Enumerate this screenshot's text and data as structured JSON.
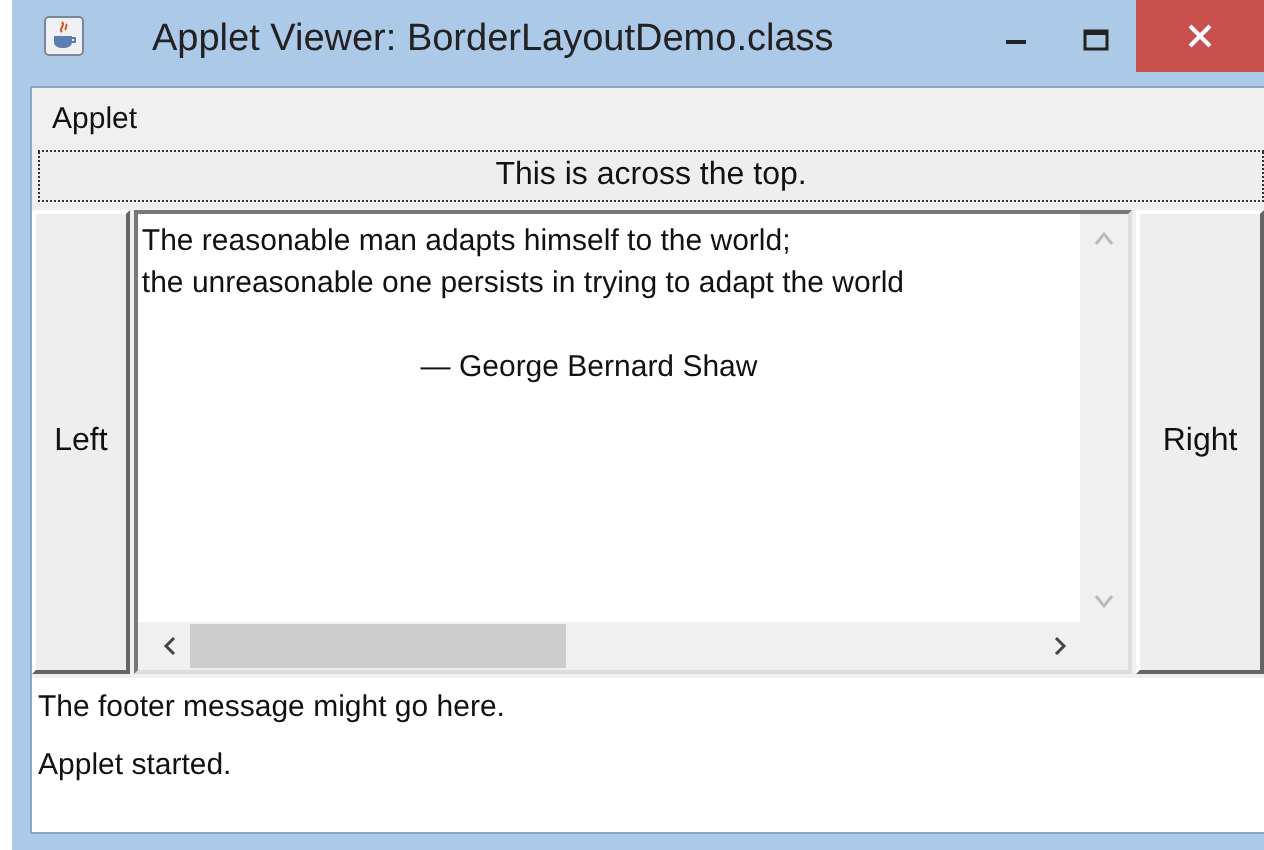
{
  "window": {
    "title": "Applet Viewer: BorderLayoutDemo.class"
  },
  "menu_bar": {
    "items": [
      "Applet"
    ]
  },
  "north_button": {
    "label": "This is across the top."
  },
  "west_button": {
    "label": "Left"
  },
  "east_button": {
    "label": "Right"
  },
  "text_area": {
    "lines": [
      "The reasonable man adapts himself to the world;",
      "the unreasonable one persists in trying to adapt the world"
    ],
    "attribution": "— George Bernard Shaw"
  },
  "footer": {
    "message": "The footer message might go here."
  },
  "status_bar": {
    "text": "Applet started."
  }
}
